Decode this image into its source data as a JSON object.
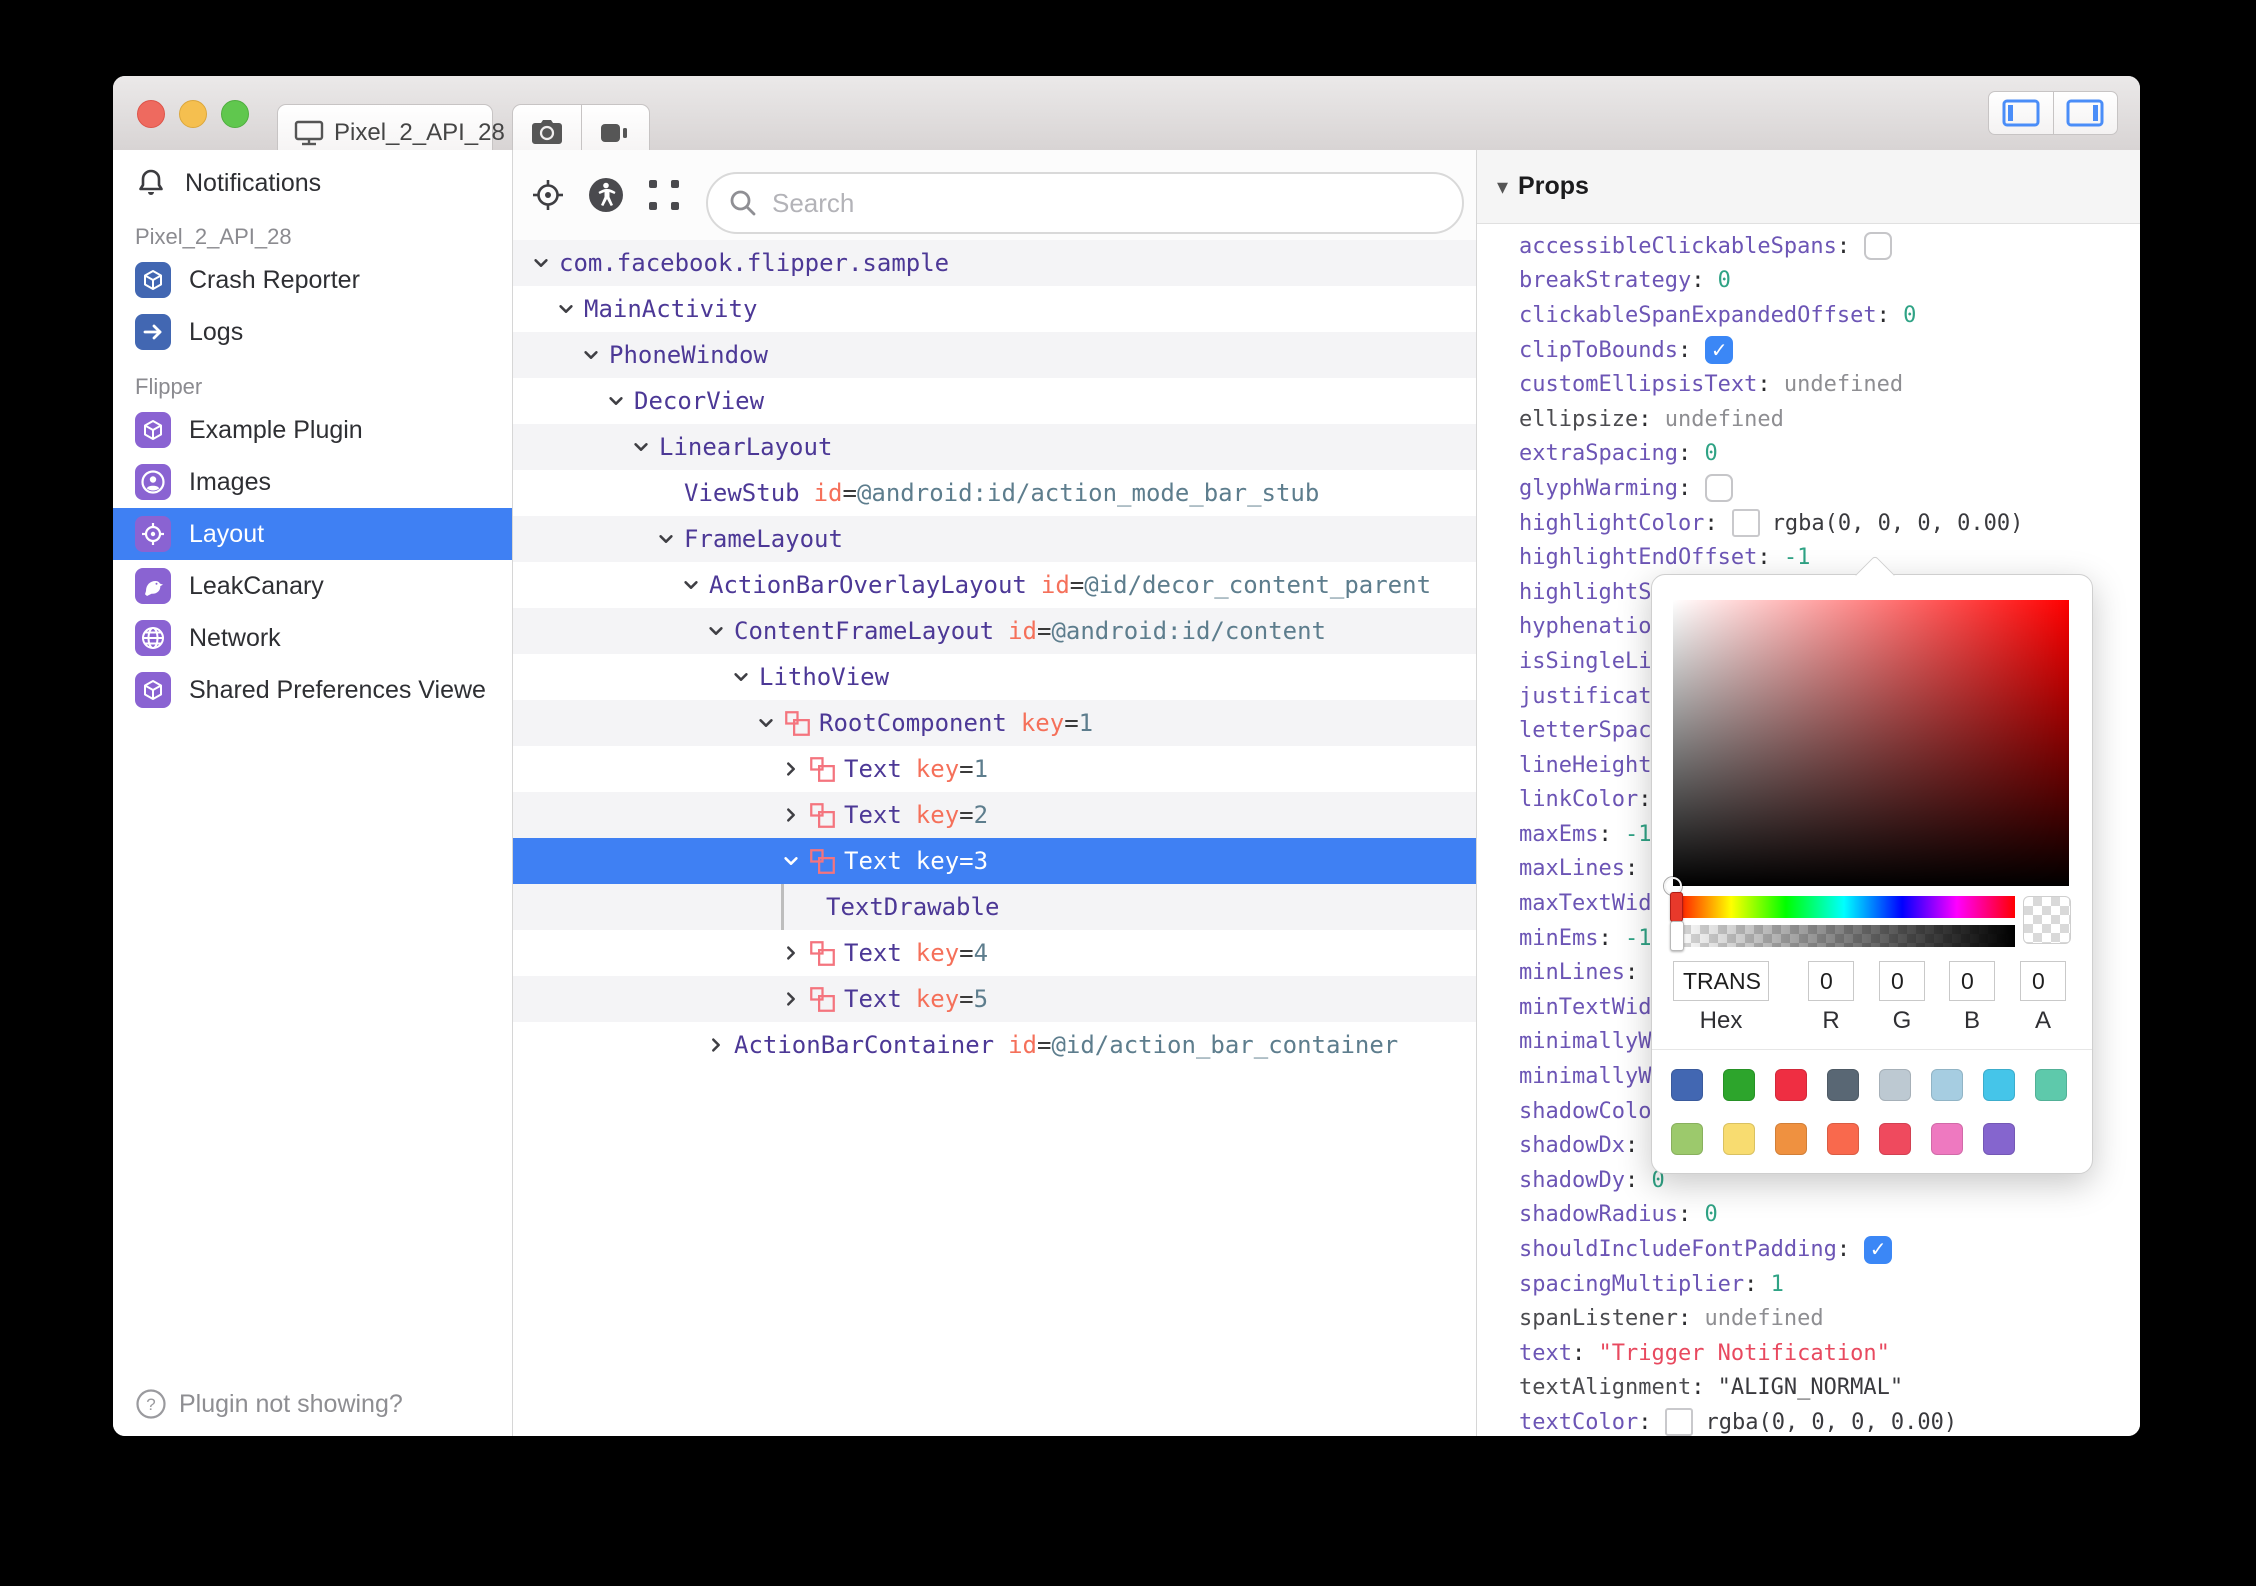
{
  "titlebar": {
    "device_button": {
      "label": "Pixel_2_API_28",
      "icon": "monitor-icon"
    },
    "screenshot_icon": "camera-icon",
    "record_icon": "video-camera-icon",
    "toggle_left_icon": "toggle-left-panel-icon",
    "toggle_right_icon": "toggle-right-panel-icon"
  },
  "sidebar": {
    "notifications": {
      "label": "Notifications",
      "icon": "bell-icon"
    },
    "sections": [
      {
        "header": "Pixel_2_API_28",
        "items": [
          {
            "label": "Crash Reporter",
            "icon": "cube-icon",
            "tile_color": "#4267b2"
          },
          {
            "label": "Logs",
            "icon": "arrow-right-icon",
            "tile_color": "#4267b2"
          }
        ]
      },
      {
        "header": "Flipper",
        "items": [
          {
            "label": "Example Plugin",
            "icon": "cube-icon",
            "tile_color": "#8a63d2"
          },
          {
            "label": "Images",
            "icon": "person-circle-icon",
            "tile_color": "#8a63d2"
          },
          {
            "label": "Layout",
            "icon": "target-icon",
            "tile_color": "#8a63d2",
            "selected": true
          },
          {
            "label": "LeakCanary",
            "icon": "bird-icon",
            "tile_color": "#8a63d2"
          },
          {
            "label": "Network",
            "icon": "globe-icon",
            "tile_color": "#8a63d2"
          },
          {
            "label": "Shared Preferences Viewe",
            "icon": "cube-icon",
            "tile_color": "#8a63d2"
          }
        ]
      }
    ],
    "footer": {
      "label": "Plugin not showing?",
      "icon": "help-circle-icon"
    }
  },
  "inspector": {
    "toolbar": {
      "icons": [
        "target-icon",
        "accessibility-icon",
        "select-element-icon"
      ],
      "search_placeholder": "Search",
      "search_icon": "search-icon"
    },
    "tree_rows": [
      {
        "level": 0,
        "chevron": "down",
        "name": "com.facebook.flipper.sample"
      },
      {
        "level": 1,
        "chevron": "down",
        "name": "MainActivity"
      },
      {
        "level": 2,
        "chevron": "down",
        "name": "PhoneWindow"
      },
      {
        "level": 3,
        "chevron": "down",
        "name": "DecorView"
      },
      {
        "level": 4,
        "chevron": "down",
        "name": "LinearLayout"
      },
      {
        "level": 5,
        "chevron": "none",
        "name": "ViewStub",
        "attr_key": "id",
        "attr_value": "@android:id/action_mode_bar_stub"
      },
      {
        "level": 5,
        "chevron": "down",
        "name": "FrameLayout"
      },
      {
        "level": 6,
        "chevron": "down",
        "name": "ActionBarOverlayLayout",
        "attr_key": "id",
        "attr_value": "@id/decor_content_parent"
      },
      {
        "level": 7,
        "chevron": "down",
        "name": "ContentFrameLayout",
        "attr_key": "id",
        "attr_value": "@android:id/content"
      },
      {
        "level": 8,
        "chevron": "down",
        "name": "LithoView"
      },
      {
        "level": 9,
        "chevron": "down",
        "icon": "litho-component-icon",
        "name": "RootComponent",
        "attr_key": "key",
        "attr_value": "1"
      },
      {
        "level": 10,
        "chevron": "right",
        "icon": "litho-component-icon",
        "name": "Text",
        "attr_key": "key",
        "attr_value": "1"
      },
      {
        "level": 10,
        "chevron": "right",
        "icon": "litho-component-icon",
        "name": "Text",
        "attr_key": "key",
        "attr_value": "2"
      },
      {
        "level": 10,
        "chevron": "down",
        "icon": "litho-component-icon",
        "name": "Text",
        "attr_key": "key",
        "attr_value": "3",
        "selected": true
      },
      {
        "level": 10,
        "chevron": "bar",
        "name": "TextDrawable"
      },
      {
        "level": 10,
        "chevron": "right",
        "icon": "litho-component-icon",
        "name": "Text",
        "attr_key": "key",
        "attr_value": "4"
      },
      {
        "level": 10,
        "chevron": "right",
        "icon": "litho-component-icon",
        "name": "Text",
        "attr_key": "key",
        "attr_value": "5"
      },
      {
        "level": 7,
        "chevron": "right",
        "name": "ActionBarContainer",
        "attr_key": "id",
        "attr_value": "@id/action_bar_container"
      }
    ]
  },
  "props_panel": {
    "title": "Props",
    "disclosure_icon_glyph": "▾",
    "check_glyph": "✓",
    "rows": [
      {
        "name": "accessibleClickableSpans",
        "name_style": "purple",
        "colon": true,
        "control": "checkbox-unchecked",
        "value": "",
        "value_style": ""
      },
      {
        "name": "breakStrategy",
        "name_style": "purple",
        "colon": true,
        "control": "",
        "value": "0",
        "value_style": "number"
      },
      {
        "name": "clickableSpanExpandedOffset",
        "name_style": "purple",
        "colon": true,
        "control": "",
        "value": "0",
        "value_style": "number"
      },
      {
        "name": "clipToBounds",
        "name_style": "purple",
        "colon": true,
        "control": "checkbox-checked",
        "value": "",
        "value_style": ""
      },
      {
        "name": "customEllipsisText",
        "name_style": "purple",
        "colon": true,
        "control": "",
        "value": "undefined",
        "value_style": "undefined"
      },
      {
        "name": "ellipsize",
        "name_style": "gray",
        "colon": true,
        "control": "",
        "value": "undefined",
        "value_style": "undefined"
      },
      {
        "name": "extraSpacing",
        "name_style": "purple",
        "colon": true,
        "control": "",
        "value": "0",
        "value_style": "number"
      },
      {
        "name": "glyphWarming",
        "name_style": "purple",
        "colon": true,
        "control": "checkbox-unchecked",
        "value": "",
        "value_style": ""
      },
      {
        "name": "highlightColor",
        "name_style": "purple",
        "colon": true,
        "control": "color-swatch",
        "value": "rgba(0, 0, 0, 0.00)",
        "value_style": "plain"
      },
      {
        "name": "highlightEndOffset",
        "name_style": "purple",
        "colon": true,
        "control": "",
        "value": "-1",
        "value_style": "number"
      },
      {
        "name": "highlightS",
        "name_style": "purple",
        "colon": false,
        "control": "",
        "value": "",
        "value_style": ""
      },
      {
        "name": "hyphenatio",
        "name_style": "purple",
        "colon": false,
        "control": "",
        "value": "",
        "value_style": ""
      },
      {
        "name": "isSingleLi",
        "name_style": "purple",
        "colon": false,
        "control": "",
        "value": "",
        "value_style": ""
      },
      {
        "name": "justificat",
        "name_style": "purple",
        "colon": false,
        "control": "",
        "value": "",
        "value_style": ""
      },
      {
        "name": "letterSpac",
        "name_style": "purple",
        "colon": false,
        "control": "",
        "value": "",
        "value_style": ""
      },
      {
        "name": "lineHeight",
        "name_style": "purple",
        "colon": false,
        "control": "",
        "value": "",
        "value_style": ""
      },
      {
        "name": "linkColor",
        "name_style": "purple",
        "colon": true,
        "control": "",
        "value": "",
        "value_style": ""
      },
      {
        "name": "maxEms",
        "name_style": "purple",
        "colon": true,
        "control": "",
        "value": "-1",
        "value_style": "number"
      },
      {
        "name": "maxLines",
        "name_style": "purple",
        "colon": true,
        "control": "",
        "value": "",
        "value_style": ""
      },
      {
        "name": "maxTextWid",
        "name_style": "purple",
        "colon": false,
        "control": "",
        "value": "",
        "value_style": ""
      },
      {
        "name": "minEms",
        "name_style": "purple",
        "colon": true,
        "control": "",
        "value": "-1",
        "value_style": "number"
      },
      {
        "name": "minLines",
        "name_style": "purple",
        "colon": true,
        "control": "",
        "value": "",
        "value_style": ""
      },
      {
        "name": "minTextWid",
        "name_style": "purple",
        "colon": false,
        "control": "",
        "value": "",
        "value_style": ""
      },
      {
        "name": "minimallyW",
        "name_style": "purple",
        "colon": false,
        "control": "",
        "value": "",
        "value_style": ""
      },
      {
        "name": "minimallyW",
        "name_style": "purple",
        "colon": false,
        "control": "",
        "value": "",
        "value_style": ""
      },
      {
        "name": "shadowColo",
        "name_style": "purple",
        "colon": false,
        "control": "",
        "value": "",
        "value_style": ""
      },
      {
        "name": "shadowDx",
        "name_style": "purple",
        "colon": true,
        "control": "",
        "value": "",
        "value_style": ""
      },
      {
        "name": "shadowDy",
        "name_style": "purple",
        "colon": true,
        "control": "",
        "value": "0",
        "value_style": "number"
      },
      {
        "name": "shadowRadius",
        "name_style": "purple",
        "colon": true,
        "control": "",
        "value": "0",
        "value_style": "number"
      },
      {
        "name": "shouldIncludeFontPadding",
        "name_style": "purple",
        "colon": true,
        "control": "checkbox-checked",
        "value": "",
        "value_style": ""
      },
      {
        "name": "spacingMultiplier",
        "name_style": "purple",
        "colon": true,
        "control": "",
        "value": "1",
        "value_style": "number"
      },
      {
        "name": "spanListener",
        "name_style": "gray",
        "colon": true,
        "control": "",
        "value": "undefined",
        "value_style": "undefined"
      },
      {
        "name": "text",
        "name_style": "purple",
        "colon": true,
        "control": "",
        "value": "\"Trigger Notification\"",
        "value_style": "string"
      },
      {
        "name": "textAlignment",
        "name_style": "gray",
        "colon": true,
        "control": "",
        "value": "\"ALIGN_NORMAL\"",
        "value_style": "plain"
      },
      {
        "name": "textColor",
        "name_style": "purple",
        "colon": true,
        "control": "color-swatch",
        "value": "rgba(0, 0, 0, 0.00)",
        "value_style": "plain"
      }
    ]
  },
  "color_picker": {
    "hex_value": "TRANS",
    "r_value": "0",
    "g_value": "0",
    "b_value": "0",
    "a_value": "0",
    "labels": {
      "hex": "Hex",
      "r": "R",
      "g": "G",
      "b": "B",
      "a": "A"
    },
    "swatches_row1": [
      "#4267b2",
      "#2da52c",
      "#ef2e42",
      "#596774",
      "#bdc9d2",
      "#a6cde1",
      "#45c5e9",
      "#5ec9ab"
    ],
    "swatches_row2": [
      "#9cc96c",
      "#f8dc70",
      "#ef9140",
      "#f9694d",
      "#ef4a5e",
      "#ee79c0",
      "#8565ce"
    ]
  },
  "colors": {
    "selection_blue": "#3f80f3",
    "row_stripe": "#f4f4f6",
    "tree_name_purple": "#4c3896",
    "attr_key_orange": "#f5705a",
    "attr_value_slate": "#5d7d8d",
    "prop_name_purple": "#6c55b5",
    "prop_number_green": "#2fa385",
    "string_red": "#e8495f",
    "litho_icon_red": "#f4747e",
    "device_tile_blue": "#4267b2",
    "flipper_tile_purple": "#8a63d2"
  }
}
